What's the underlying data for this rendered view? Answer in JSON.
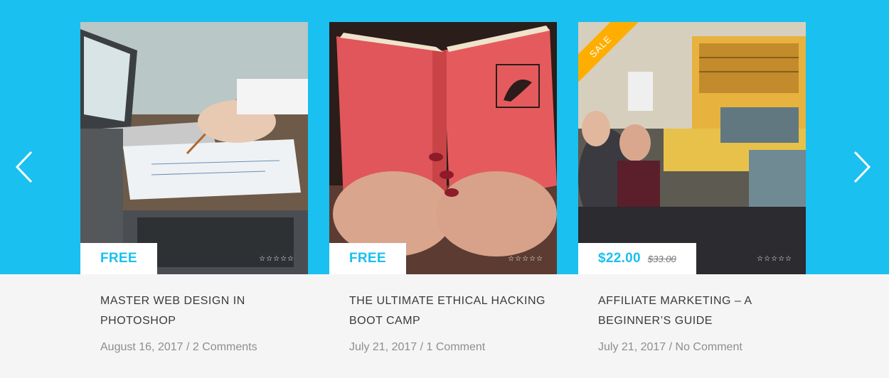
{
  "colors": {
    "accent": "#1ac0ef",
    "sale": "#ffae00",
    "panel": "#f5f5f5"
  },
  "nav": {
    "prev_icon": "chevron-left-icon",
    "next_icon": "chevron-right-icon"
  },
  "courses": [
    {
      "title": "MASTER WEB DESIGN IN PHOTOSHOP",
      "price": "FREE",
      "old_price": "",
      "sale": false,
      "rating_stars": 0,
      "date": "August 16, 2017",
      "separator": " / ",
      "comments": "2 Comments"
    },
    {
      "title": "THE ULTIMATE ETHICAL HACKING BOOT CAMP",
      "price": "FREE",
      "old_price": "",
      "sale": false,
      "rating_stars": 0,
      "date": "July 21, 2017",
      "separator": " / ",
      "comments": "1 Comment"
    },
    {
      "title": "AFFILIATE MARKETING – A BEGINNER’S GUIDE",
      "price": "$22.00",
      "old_price": "$33.00",
      "sale": true,
      "sale_label": "SALE",
      "rating_stars": 0,
      "date": "July 21, 2017",
      "separator": " / ",
      "comments": "No Comment"
    }
  ]
}
